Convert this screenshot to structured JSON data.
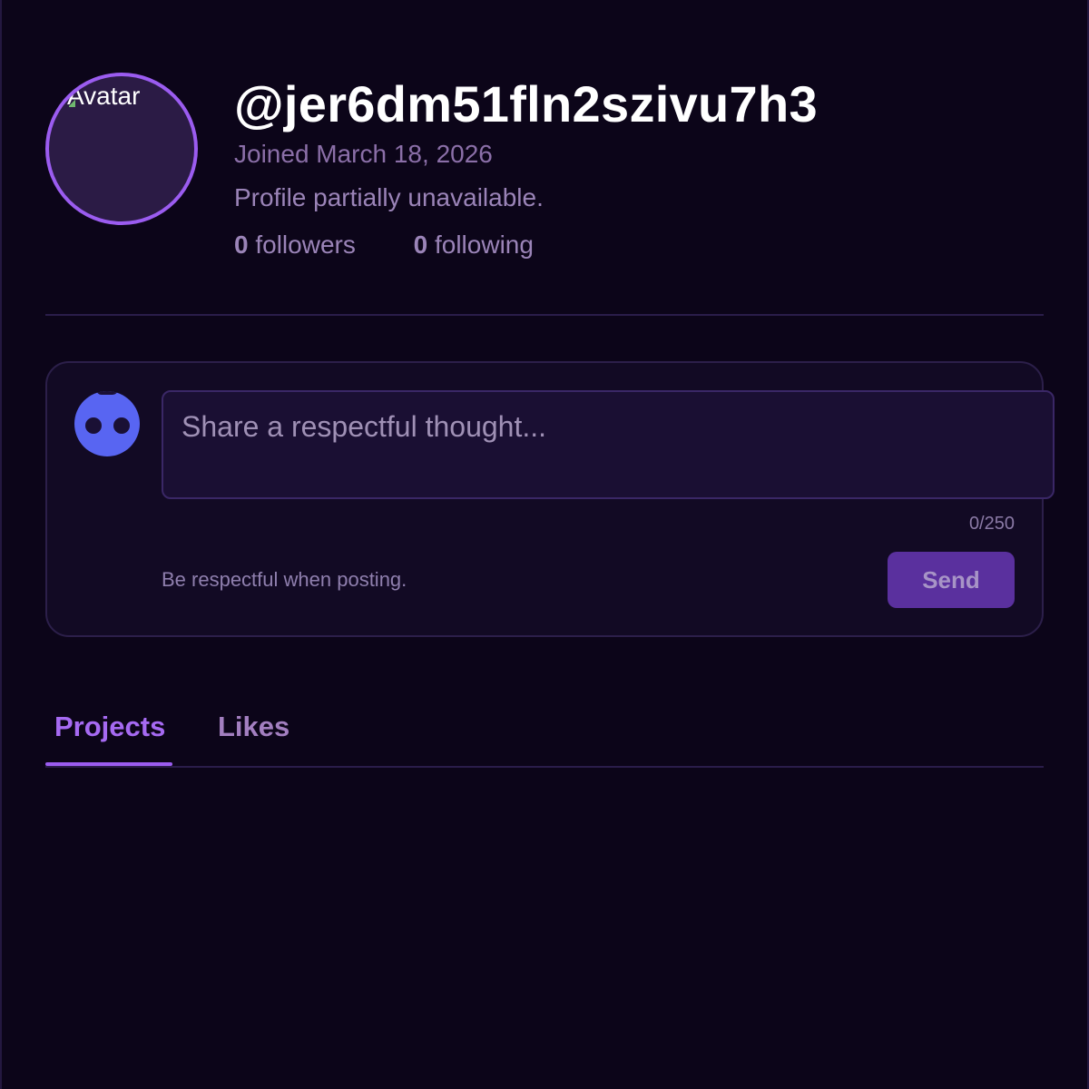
{
  "profile": {
    "avatar_alt": "Avatar",
    "username": "@jer6dm51fln2szivu7h3",
    "joined": "Joined March 18, 2026",
    "status": "Profile partially unavailable.",
    "followers_count": "0",
    "followers_label": "followers",
    "following_count": "0",
    "following_label": "following"
  },
  "composer": {
    "placeholder": "Share a respectful thought...",
    "counter": "0/250",
    "hint": "Be respectful when posting.",
    "send_label": "Send"
  },
  "tabs": [
    {
      "label": "Projects",
      "active": true
    },
    {
      "label": "Likes",
      "active": false
    }
  ],
  "colors": {
    "background": "#0c0519",
    "accent": "#9b5cf0",
    "discord": "#5865f2",
    "send_button": "#5a309e"
  },
  "icons": {
    "composer_avatar": "discord-icon",
    "avatar_broken": "broken-image-icon"
  }
}
